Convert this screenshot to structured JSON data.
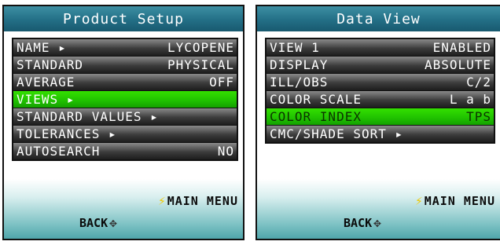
{
  "product_setup": {
    "title": "Product Setup",
    "items": [
      {
        "label": "NAME ▸",
        "value": "LYCOPENE",
        "selected": false
      },
      {
        "label": "STANDARD",
        "value": "PHYSICAL",
        "selected": false
      },
      {
        "label": "AVERAGE",
        "value": "OFF",
        "selected": false
      },
      {
        "label": "VIEWS ▸",
        "value": "",
        "selected": true
      },
      {
        "label": "STANDARD VALUES ▸",
        "value": "",
        "selected": false
      },
      {
        "label": "TOLERANCES ▸",
        "value": "",
        "selected": false
      },
      {
        "label": "AUTOSEARCH",
        "value": "NO",
        "selected": false
      }
    ],
    "main_menu_label": "MAIN MENU",
    "back_label": "BACK"
  },
  "data_view": {
    "title": "Data View",
    "items": [
      {
        "label": "VIEW 1",
        "value": "ENABLED",
        "selected": false
      },
      {
        "label": "DISPLAY",
        "value": "ABSOLUTE",
        "selected": false
      },
      {
        "label": "ILL/OBS",
        "value": "C/2",
        "selected": false
      },
      {
        "label": "COLOR SCALE",
        "value": "L a b",
        "selected": false
      },
      {
        "label": "COLOR INDEX",
        "value": "TPS",
        "selected": true
      },
      {
        "label": "CMC/SHADE SORT ▸",
        "value": "",
        "selected": false
      }
    ],
    "main_menu_label": "MAIN MENU",
    "back_label": "BACK"
  },
  "icons": {
    "main_menu": "lightning-bolt-icon",
    "back": "directional-pad-icon"
  },
  "colors": {
    "title_bar": "#236f86",
    "selected_row": "#1fc000",
    "row_dark": "#1d1d1d",
    "footer": "#4fa6ab",
    "bolt": "#f0c800"
  }
}
